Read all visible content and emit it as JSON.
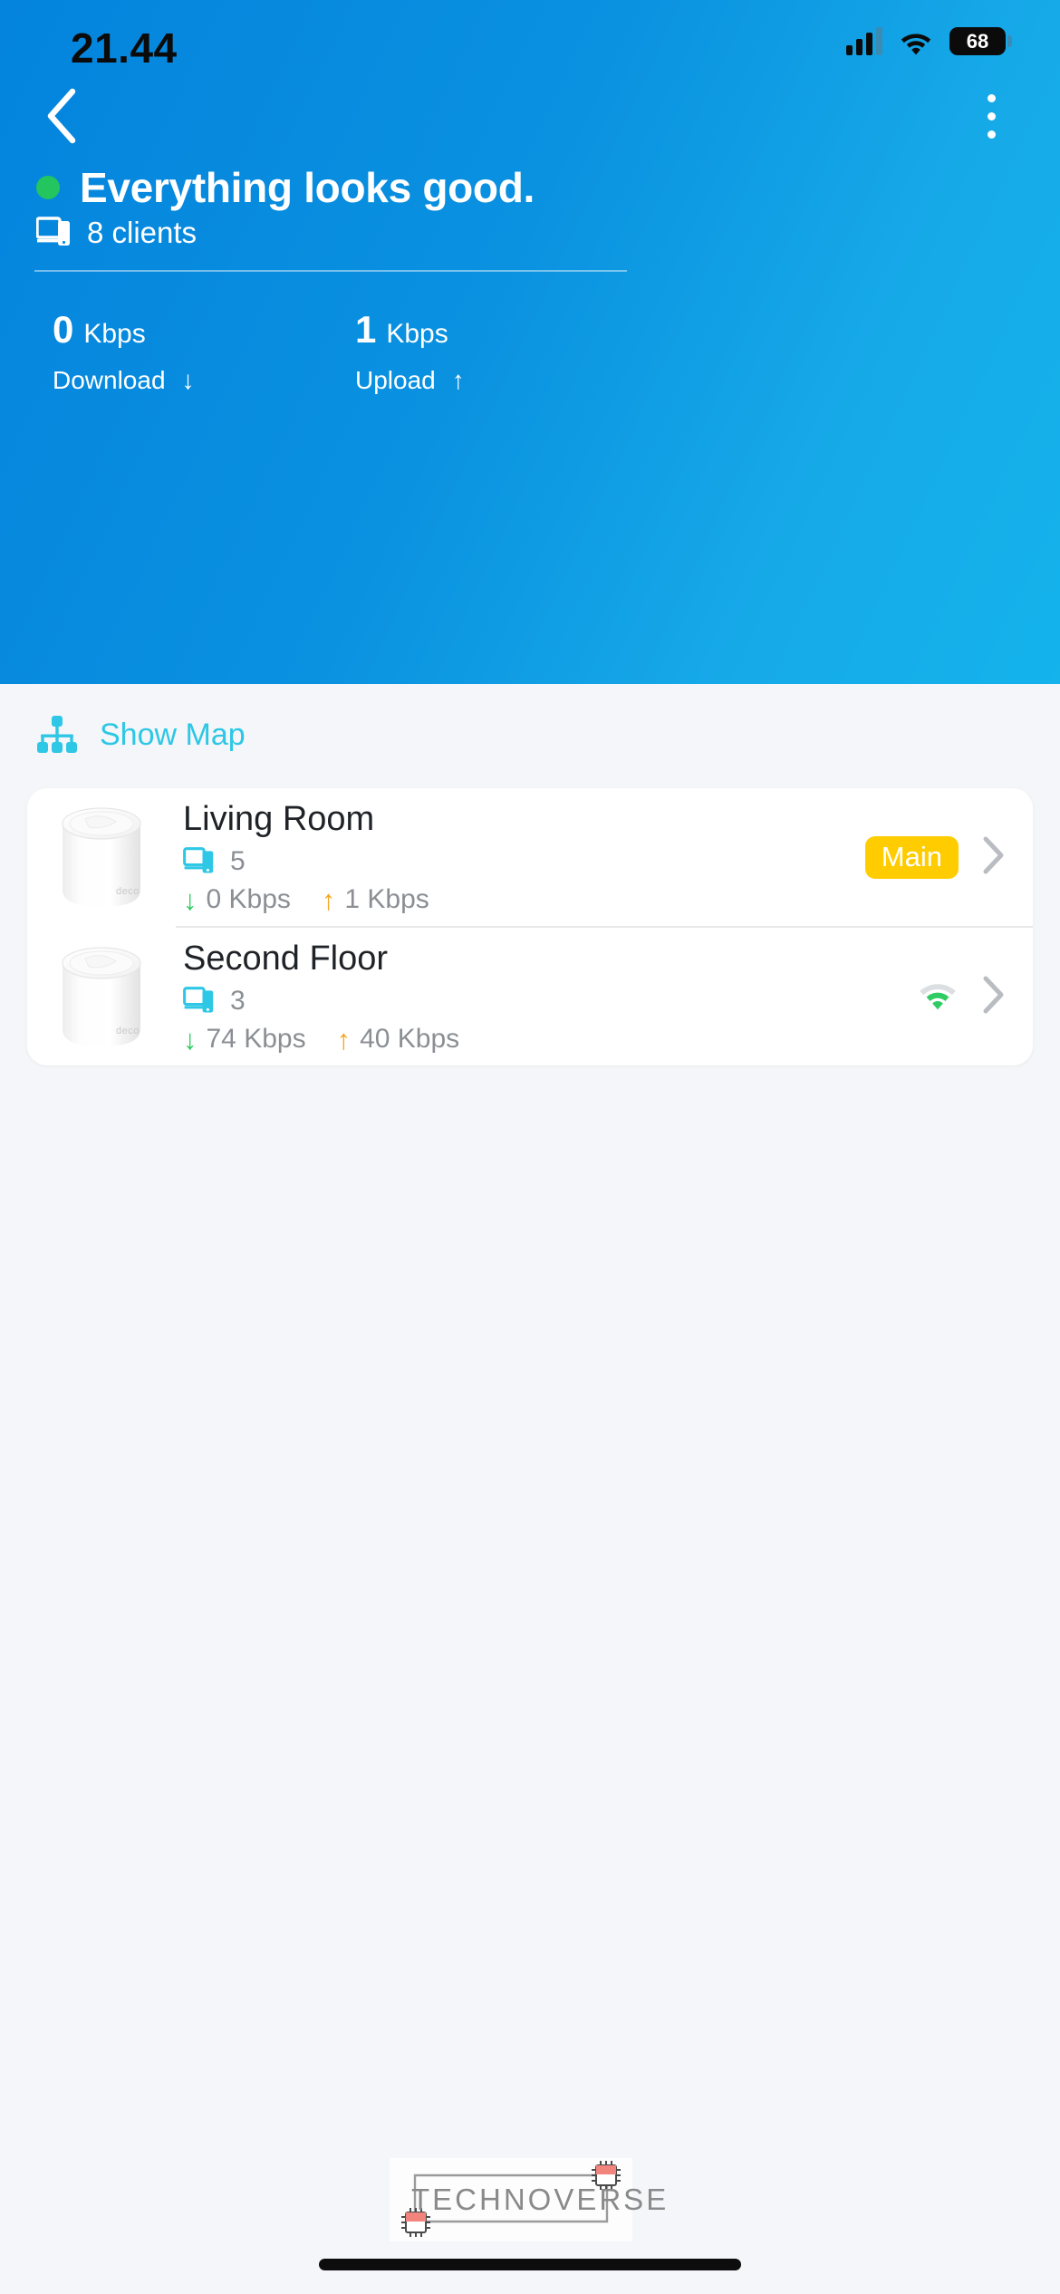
{
  "status_bar": {
    "time": "21.44",
    "battery_level": "68",
    "signal_icon": "cellular-signal-icon",
    "wifi_icon": "wifi-icon"
  },
  "nav": {
    "back_icon": "chevron-left-icon",
    "menu_icon": "more-vertical-icon"
  },
  "header": {
    "status_indicator_color": "#22c55e",
    "status_title": "Everything looks good.",
    "clients_icon": "devices-icon",
    "clients_text": "8 clients",
    "download": {
      "value": "0",
      "unit": "Kbps",
      "label": "Download",
      "arrow": "↓"
    },
    "upload": {
      "value": "1",
      "unit": "Kbps",
      "label": "Upload",
      "arrow": "↑"
    },
    "gradient_from": "#0484dd",
    "gradient_to": "#14b3ec"
  },
  "show_map": {
    "icon": "network-topology-icon",
    "label": "Show Map",
    "color": "#2ec7e6"
  },
  "devices": [
    {
      "name": "Living Room",
      "thumb_icon": "deco-router-icon",
      "clients_icon": "devices-icon",
      "clients": "5",
      "download_arrow": "↓",
      "download": "0 Kbps",
      "upload_arrow": "↑",
      "upload": "1 Kbps",
      "badge": "Main",
      "badge_color": "#ffcc00",
      "signal_icon": null,
      "chevron_icon": "chevron-right-icon"
    },
    {
      "name": "Second Floor",
      "thumb_icon": "deco-router-icon",
      "clients_icon": "devices-icon",
      "clients": "3",
      "download_arrow": "↓",
      "download": "74 Kbps",
      "upload_arrow": "↑",
      "upload": "40 Kbps",
      "badge": null,
      "badge_color": null,
      "signal_icon": "wifi-signal-icon",
      "chevron_icon": "chevron-right-icon"
    }
  ],
  "watermark": {
    "text": "TECHNOVERSE"
  }
}
